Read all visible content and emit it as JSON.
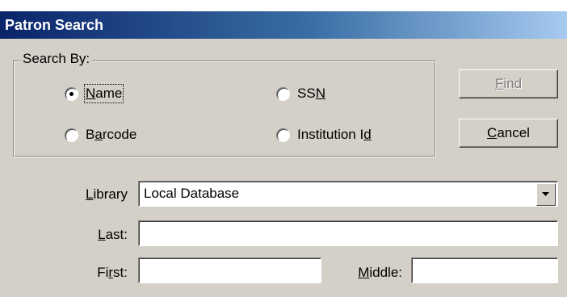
{
  "window": {
    "title": "Patron Search"
  },
  "search_by": {
    "label": "Search By:",
    "options": [
      {
        "label_pre": "",
        "label_u": "N",
        "label_post": "ame",
        "checked": true
      },
      {
        "label_pre": "SS",
        "label_u": "N",
        "label_post": "",
        "checked": false
      },
      {
        "label_pre": "B",
        "label_u": "a",
        "label_post": "rcode",
        "checked": false
      },
      {
        "label_pre": "Institution I",
        "label_u": "d",
        "label_post": "",
        "checked": false
      }
    ]
  },
  "buttons": {
    "find": {
      "u": "F",
      "rest": "ind",
      "enabled": false
    },
    "cancel": {
      "u": "C",
      "rest": "ancel",
      "enabled": true
    }
  },
  "fields": {
    "library": {
      "label_u": "L",
      "label_rest": "ibrary",
      "value": "Local Database"
    },
    "last": {
      "label_u": "L",
      "label_rest": "ast:",
      "value": ""
    },
    "first": {
      "label_pre": "Fi",
      "label_u": "r",
      "label_rest": "st:",
      "value": ""
    },
    "middle": {
      "label_u": "M",
      "label_rest": "iddle:",
      "value": ""
    }
  }
}
